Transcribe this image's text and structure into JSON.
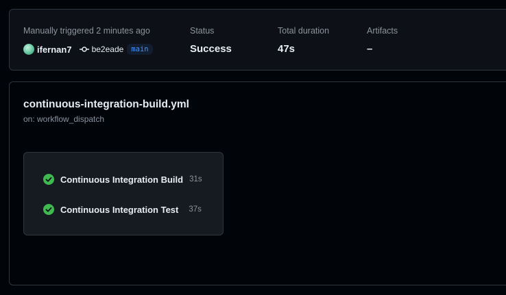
{
  "summary": {
    "trigger_label": "Manually triggered 2 minutes ago",
    "actor": "ifernan7",
    "commit_sha": "be2eade",
    "branch": "main",
    "status_label": "Status",
    "status_value": "Success",
    "duration_label": "Total duration",
    "duration_value": "47s",
    "artifacts_label": "Artifacts",
    "artifacts_value": "–"
  },
  "workflow": {
    "file": "continuous-integration-build.yml",
    "trigger": "on: workflow_dispatch",
    "jobs": [
      {
        "name": "Continuous Integration Build",
        "duration": "31s",
        "status": "success-icon"
      },
      {
        "name": "Continuous Integration Test",
        "duration": "37s",
        "status": "success-icon"
      }
    ]
  },
  "colors": {
    "background": "#010409",
    "success": "#3fb950",
    "link": "#4493f8",
    "border": "#30363d"
  }
}
